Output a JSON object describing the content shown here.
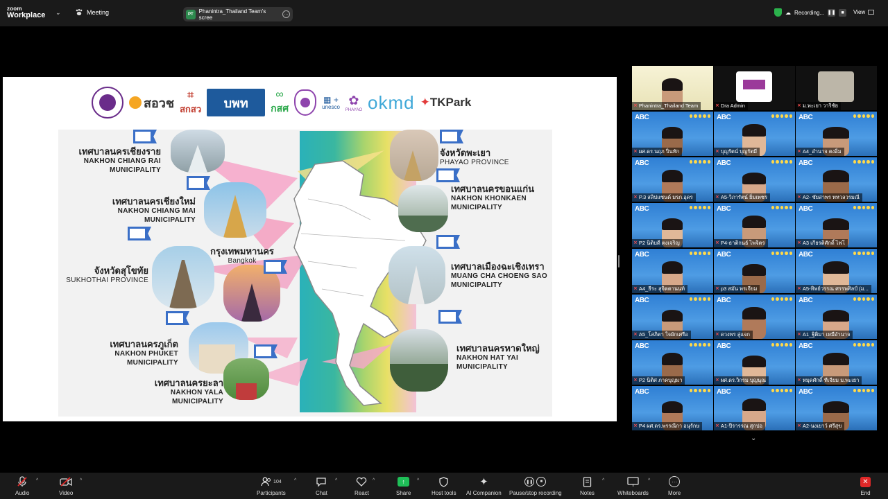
{
  "app": {
    "logo_top": "zoom",
    "logo_bottom": "Workplace",
    "meeting_label": "Meeting"
  },
  "share_pill": {
    "badge": "PT",
    "text": "Phanintra_Thailand Team's scree"
  },
  "recording": {
    "label": "Recording..."
  },
  "view_label": "View",
  "slide": {
    "logos": [
      "สอวช",
      "สกสว",
      "บพท",
      "กสศ",
      "unesco",
      "PHAYAO",
      "okmd",
      "TKPark"
    ],
    "cities": [
      {
        "th": "เทศบาลนครเชียงราย",
        "en1": "NAKHON CHIANG RAI",
        "en2": "MUNICIPALITY"
      },
      {
        "th": "เทศบาลนครเชียงใหม่",
        "en1": "NAKHON CHIANG MAI",
        "en2": "MUNICIPALITY"
      },
      {
        "th": "จังหวัดสุโขทัย",
        "en1": "SUKHOTHAI PROVINCE",
        "en2": ""
      },
      {
        "th": "เทศบาลนครภูเก็ต",
        "en1": "NAKHON PHUKET",
        "en2": "MUNICIPALITY"
      },
      {
        "th": "เทศบาลนครยะลา",
        "en1": "NAKHON YALA",
        "en2": "MUNICIPALITY"
      },
      {
        "th": "จังหวัดพะเยา",
        "en1": "PHAYAO PROVINCE",
        "en2": ""
      },
      {
        "th": "เทศบาลนครขอนแก่น",
        "en1": "NAKHON KHONKAEN",
        "en2": "MUNICIPALITY"
      },
      {
        "th": "เทศบาลเมืองฉะเชิงเทรา",
        "en1": "MUANG CHA CHOENG SAO",
        "en2": "MUNICIPALITY"
      },
      {
        "th": "เทศบาลนครหาดใหญ่",
        "en1": "NAKHON HAT YAI",
        "en2": "MUNICIPALITY"
      },
      {
        "th": "กรุงเทพมหานคร",
        "en1": "Bangkok",
        "en2": ""
      }
    ]
  },
  "participants": [
    "Phanintra_Thailand Team",
    "Dra Admin",
    "ม.พะเยา วาริชัย",
    "ผศ.ดร.นฤภ ปิ่นทัก",
    "บุญรัตน์ บุญรัตมี",
    "A4_อำนาจ ตงอิ่ม",
    "P.3 สลิปแซนด์ มรภ.อุดร",
    "A5-วิภารัตน์ ยิ่มเพชร",
    "A2- ชัยสาพร ทหวลวรมณี",
    "P2 นิติบดี ตงเจริญ",
    "P4-ธาติกนธ์ ไพจิตร",
    "A3 เกียรติศักดิ์ ไฟโ",
    "A4_ธีระ สุจิตตานนท์",
    "p3 สมัน พรเจียม",
    "A5-ทิพย์วรรณ ศรรพศิลป์ (ม...",
    "A5_โสภิตา ใจผักเศรือ",
    "ดวงพร ลู่แจก",
    "A1_ฐิติมา เหมือำนาจ",
    "P2 นิติศ ภาคบุญมา",
    "ผศ.ดร.วิกรม บุญนุณ",
    "หมุดศักดิ์ ทีเจียม ม.พะเยา",
    "P4 ผศ.ดร.พรรณีกา อนุรักษ",
    "A1-ปีรารรณ สุกปอ",
    "A2-นงเยาว์ ศรีสุข"
  ],
  "toolbar": {
    "audio": "Audio",
    "video": "Video",
    "participants": "Participants",
    "participants_count": "104",
    "chat": "Chat",
    "react": "React",
    "share": "Share",
    "host_tools": "Host tools",
    "ai_companion": "AI Companion",
    "pause_recording": "Pause/stop recording",
    "notes": "Notes",
    "whiteboards": "Whiteboards",
    "more": "More",
    "end": "End"
  },
  "colors": {
    "accent_green": "#1fbf58",
    "end_red": "#e02828",
    "tile_blue": "#2f7fd4"
  }
}
